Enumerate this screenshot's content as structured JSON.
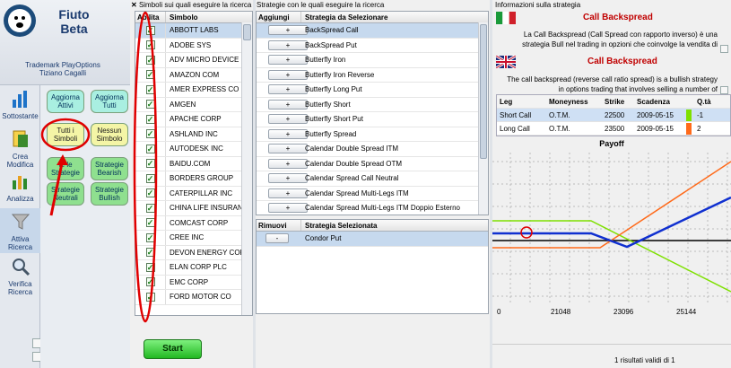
{
  "app": {
    "title_line1": "Fiuto",
    "title_line2": "Beta",
    "trademark": "Trademark PlayOptions",
    "author": "Tiziano Cagalli"
  },
  "nav": [
    {
      "label_lines": [
        "Sottostante"
      ],
      "icon": "bar-chart-icon"
    },
    {
      "label_lines": [
        "Crea",
        "Modifica"
      ],
      "icon": "document-edit-icon"
    },
    {
      "label_lines": [
        "Analizza"
      ],
      "icon": "analysis-chart-icon"
    },
    {
      "label_lines": [
        "Attiva",
        "Ricerca"
      ],
      "icon": "funnel-icon"
    },
    {
      "label_lines": [
        "Verifica",
        "Ricerca"
      ],
      "icon": "magnifier-icon"
    }
  ],
  "buttons": {
    "aggiorna_attivi": [
      "Aggiorna",
      "Attivi"
    ],
    "aggiorna_tutti": [
      "Aggiorna",
      "Tutti"
    ],
    "tutti_simboli": [
      "Tutti i",
      "Simboli"
    ],
    "nessun_simbolo": [
      "Nessun",
      "Simbolo"
    ],
    "strategie_le": [
      "te le",
      "Strategie"
    ],
    "strategie_bearish": [
      "Strategie",
      "Bearish"
    ],
    "strategie_neutrali": [
      "Strategie",
      "Neutrali"
    ],
    "strategie_bullish": [
      "Strategie",
      "Bullish"
    ],
    "start": "Start"
  },
  "symbols_panel": {
    "title": "Simboli sui quali eseguire la ricerca",
    "col_abilita": "Abilita",
    "col_simbolo": "Simbolo",
    "rows": [
      "ABBOTT LABS",
      "ADOBE SYS",
      "ADV MICRO DEVICE",
      "AMAZON COM",
      "AMER EXPRESS CO",
      "AMGEN",
      "APACHE CORP",
      "ASHLAND INC",
      "AUTODESK INC",
      "BAIDU.COM",
      "BORDERS GROUP",
      "CATERPILLAR INC",
      "CHINA LIFE INSURAN",
      "COMCAST CORP",
      "CREE INC",
      "DEVON ENERGY CORF",
      "ELAN CORP PLC",
      "EMC CORP",
      "FORD MOTOR CO"
    ]
  },
  "strategies_panel": {
    "title": "Strategie con le quali eseguire la ricerca",
    "col_add": "Aggiungi",
    "col_name": "Strategia da Selezionare",
    "add_symbol": "+",
    "rows": [
      "BackSpread Call",
      "BackSpread Put",
      "Butterfly Iron",
      "Butterfly Iron Reverse",
      "Butterfly Long Put",
      "Butterfly Short",
      "Butterfly Short Put",
      "Butterfly Spread",
      "Calendar Double Spread ITM",
      "Calendar Double Spread OTM",
      "Calendar Spread Call Neutral",
      "Calendar Spread Multi-Legs  ITM",
      "Calendar Spread Multi-Legs ITM Doppio Esterno"
    ]
  },
  "selected_panel": {
    "col_remove": "Rimuovi",
    "col_name": "Strategia Selezionata",
    "remove_symbol": "-",
    "rows": [
      "Condor Put"
    ]
  },
  "info_panel": {
    "title": "Informazioni sulla strategia",
    "it_heading": "Call Backspread",
    "it_text": "La Call Backspread (Call Spread con rapporto inverso) è una strategia Bull nel trading in opzioni che coinvolge la vendita di",
    "en_heading": "Call Backspread",
    "en_text": "The call backspread (reverse call ratio spread) is a bullish strategy in options trading that involves selling a number of",
    "legs_headers": [
      "Leg",
      "Moneyness",
      "Strike",
      "Scadenza",
      "Q.tà"
    ],
    "legs": [
      {
        "leg": "Short Call",
        "moneyness": "O.T.M.",
        "strike": "22500",
        "scadenza": "2009-05-15",
        "qty": "-1",
        "color": "#7ee000"
      },
      {
        "leg": "Long Call",
        "moneyness": "O.T.M.",
        "strike": "23500",
        "scadenza": "2009-05-15",
        "qty": "2",
        "color": "#ff6a1a"
      }
    ],
    "payoff_title": "Payoff",
    "x_ticks": [
      "0",
      "21048",
      "23096",
      "25144"
    ],
    "result_text": "1 risultati validi di 1"
  },
  "colors": {
    "red_annotation": "#e00000",
    "selection": "#c6d9ee",
    "start_green": "#22b822"
  }
}
